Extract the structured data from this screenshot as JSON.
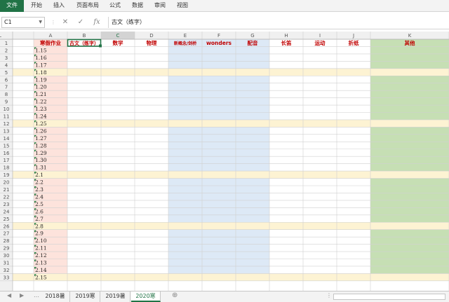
{
  "ribbon": {
    "tabs": [
      "文件",
      "开始",
      "插入",
      "页面布局",
      "公式",
      "数据",
      "审阅",
      "视图"
    ]
  },
  "formula_bar": {
    "name_box": "C1",
    "cancel_glyph": "✕",
    "enter_glyph": "✓",
    "fx_glyph": "fx",
    "content": "古文（练字）"
  },
  "grid": {
    "columns": [
      "A",
      "B",
      "C",
      "D",
      "E",
      "F",
      "G",
      "H",
      "I",
      "J",
      "K",
      "L"
    ],
    "selected_column": "C",
    "headers": [
      "",
      "寒假作业",
      "古文（练字）",
      "数学",
      "物理",
      "新概念/剑桥",
      "wonders",
      "配音",
      "长笛",
      "运动",
      "折纸",
      "其他"
    ],
    "rows": [
      {
        "num": "1"
      },
      {
        "num": "2",
        "date": "1.15"
      },
      {
        "num": "3",
        "date": "1.16"
      },
      {
        "num": "4",
        "date": "1.17"
      },
      {
        "num": "5",
        "date": "1.18",
        "weekend": true
      },
      {
        "num": "6",
        "date": "1.19"
      },
      {
        "num": "7",
        "date": "1.20"
      },
      {
        "num": "8",
        "date": "1.21"
      },
      {
        "num": "9",
        "date": "1.22"
      },
      {
        "num": "10",
        "date": "1.23"
      },
      {
        "num": "11",
        "date": "1.24"
      },
      {
        "num": "12",
        "date": "1.25",
        "weekend": true
      },
      {
        "num": "13",
        "date": "1.26"
      },
      {
        "num": "14",
        "date": "1.27"
      },
      {
        "num": "15",
        "date": "1.28"
      },
      {
        "num": "16",
        "date": "1.29"
      },
      {
        "num": "17",
        "date": "1.30"
      },
      {
        "num": "18",
        "date": "1.31"
      },
      {
        "num": "19",
        "date": "2.1",
        "weekend": true
      },
      {
        "num": "20",
        "date": "2.2"
      },
      {
        "num": "21",
        "date": "2.3"
      },
      {
        "num": "22",
        "date": "2.4"
      },
      {
        "num": "23",
        "date": "2.5"
      },
      {
        "num": "24",
        "date": "2.6"
      },
      {
        "num": "25",
        "date": "2.7"
      },
      {
        "num": "26",
        "date": "2.8",
        "weekend": true
      },
      {
        "num": "27",
        "date": "2.9"
      },
      {
        "num": "28",
        "date": "2.10"
      },
      {
        "num": "29",
        "date": "2.11"
      },
      {
        "num": "30",
        "date": "2.12"
      },
      {
        "num": "31",
        "date": "2.13"
      },
      {
        "num": "32",
        "date": "2.14"
      },
      {
        "num": "33",
        "date": "2.15",
        "weekend": true
      }
    ]
  },
  "sheet_tabs": [
    "2018暑",
    "2019寒",
    "2019暑",
    "2020寒"
  ],
  "active_sheet": "2020寒",
  "add_sheet_glyph": "⊕",
  "colors": {
    "pink": "#fde3dc",
    "blue": "#dde9f6",
    "green": "#c6dfb4",
    "weekend": "#fdf3d3",
    "header_red": "#c00000",
    "excel_green": "#217346"
  }
}
